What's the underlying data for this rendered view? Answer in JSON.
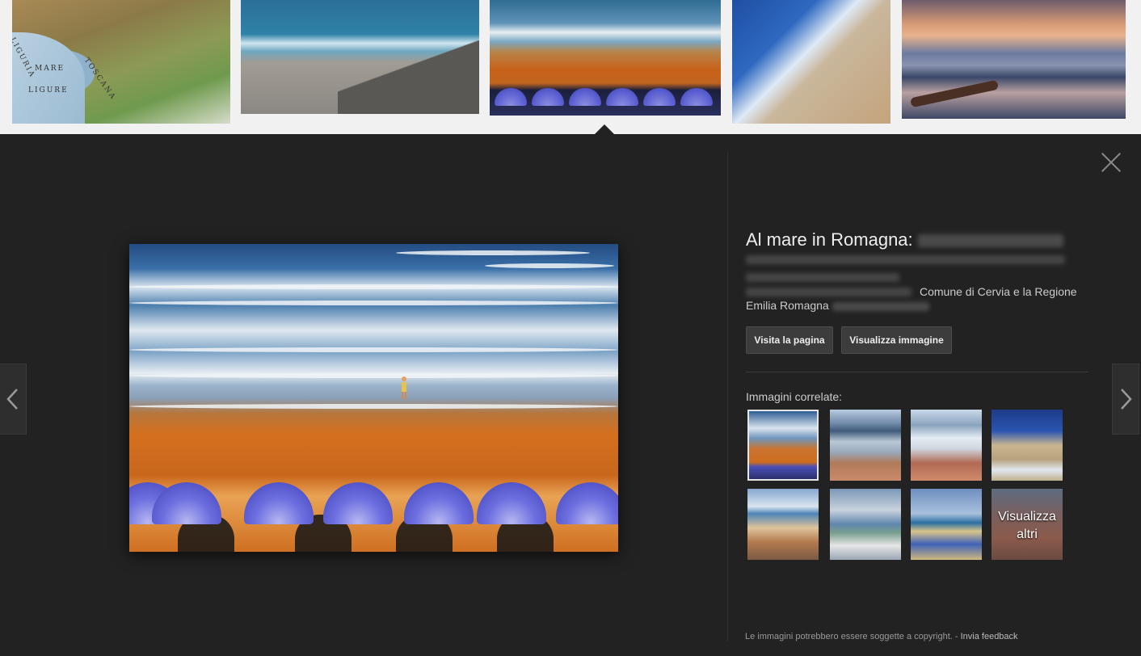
{
  "results_strip": {
    "map_labels": [
      "LIGURIA",
      "TOSCANA",
      "MARE",
      "LIGURE"
    ]
  },
  "viewer": {
    "title": "Al mare in Romagna:",
    "description_line_a": "Comune di Cervia e la Regione",
    "description_line_b": "Emilia Romagna",
    "visit_button": "Visita la pagina",
    "view_button": "Visualizza immagine",
    "related_label": "Immagini correlate:",
    "more_label_1": "Visualizza",
    "more_label_2": "altri",
    "footer_note": "Le immagini potrebbero essere soggette a copyright.",
    "footer_sep": " - ",
    "feedback_link": "Invia feedback"
  },
  "colors": {
    "viewer_bg": "#222222",
    "strip_bg": "#f1f1f1",
    "button_bg": "#3c3c3c"
  }
}
